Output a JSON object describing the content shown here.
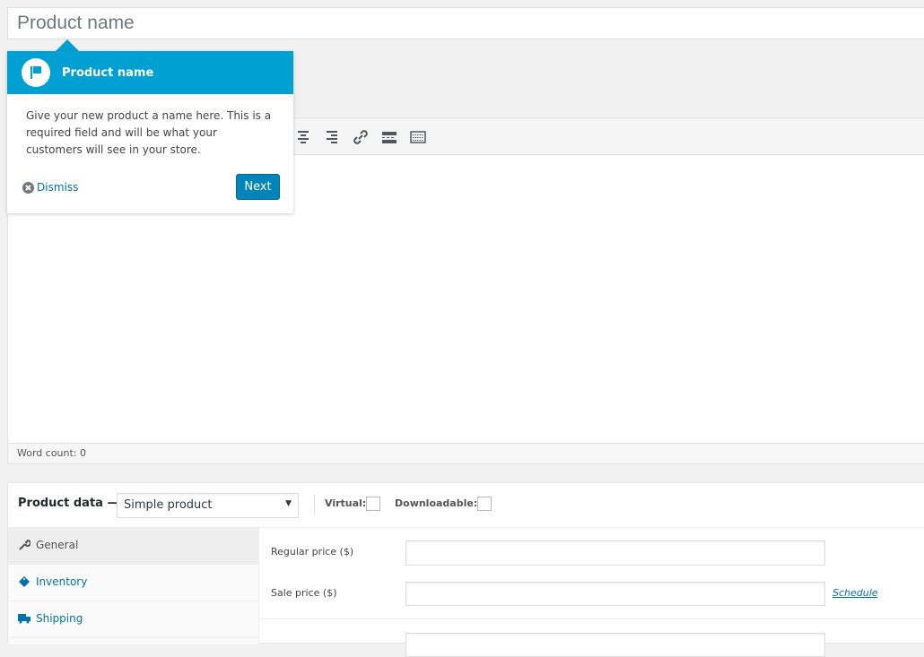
{
  "title_input": {
    "placeholder": "Product name"
  },
  "tooltip": {
    "title": "Product name",
    "body": "Give your new product a name here. This is a required field and will be what your customers will see in your store.",
    "dismiss": "Dismiss",
    "next": "Next",
    "accent": "#00a0d2"
  },
  "editor": {
    "word_count": "Word count: 0",
    "toolbar_icons": [
      "align-center-icon",
      "align-right-icon",
      "link-icon",
      "read-more-icon",
      "toolbar-toggle-icon"
    ]
  },
  "product_data": {
    "label": "Product data —",
    "type_select": "Simple product",
    "virtual": "Virtual:",
    "downloadable": "Downloadable:",
    "tabs": [
      {
        "label": "General",
        "icon": "wrench-icon"
      },
      {
        "label": "Inventory",
        "icon": "tag-icon"
      },
      {
        "label": "Shipping",
        "icon": "truck-icon"
      }
    ],
    "fields": {
      "regular_price": "Regular price ($)",
      "sale_price": "Sale price ($)",
      "schedule": "Schedule"
    }
  }
}
